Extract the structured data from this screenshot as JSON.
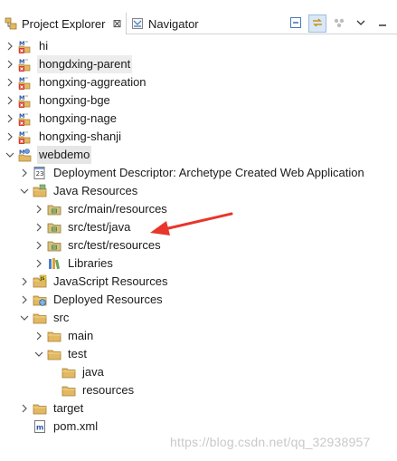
{
  "tabs": [
    {
      "label": "Project Explorer",
      "icon": "project-explorer-icon",
      "close": "⊠"
    },
    {
      "label": "Navigator",
      "icon": "navigator-icon"
    }
  ],
  "toolbar": [
    "collapse-all-icon",
    "link-with-editor-icon",
    "focus-icon",
    "view-menu-icon",
    "minimize-icon"
  ],
  "tree": [
    {
      "label": "hi",
      "icon": "maven-project-error-icon"
    },
    {
      "label": "hongdxing-parent",
      "icon": "maven-project-error-icon"
    },
    {
      "label": "hongxing-aggreation",
      "icon": "maven-project-error-icon"
    },
    {
      "label": "hongxing-bge",
      "icon": "maven-project-error-icon"
    },
    {
      "label": "hongxing-nage",
      "icon": "maven-project-error-icon"
    },
    {
      "label": "hongxing-shanji",
      "icon": "maven-project-error-icon"
    },
    {
      "label": "webdemo",
      "icon": "maven-web-project-icon"
    },
    {
      "label": "Deployment Descriptor: Archetype Created Web Application",
      "icon": "deployment-descriptor-icon"
    },
    {
      "label": "Java Resources",
      "icon": "java-resources-icon"
    },
    {
      "label": "src/main/resources",
      "icon": "source-folder-icon"
    },
    {
      "label": "src/test/java",
      "icon": "source-folder-icon"
    },
    {
      "label": "src/test/resources",
      "icon": "source-folder-icon"
    },
    {
      "label": "Libraries",
      "icon": "libraries-icon"
    },
    {
      "label": "JavaScript Resources",
      "icon": "javascript-resources-icon"
    },
    {
      "label": "Deployed Resources",
      "icon": "deployed-resources-icon"
    },
    {
      "label": "src",
      "icon": "folder-icon"
    },
    {
      "label": "main",
      "icon": "folder-icon"
    },
    {
      "label": "test",
      "icon": "folder-icon"
    },
    {
      "label": "java",
      "icon": "folder-icon"
    },
    {
      "label": "resources",
      "icon": "folder-icon"
    },
    {
      "label": "target",
      "icon": "folder-icon"
    },
    {
      "label": "pom.xml",
      "icon": "xml-file-icon"
    }
  ],
  "watermark": "https://blog.csdn.net/qq_32938957",
  "colors": {
    "arrow": "#e8362a",
    "folder": "#e2b863",
    "selection": "#e6e6e6"
  }
}
